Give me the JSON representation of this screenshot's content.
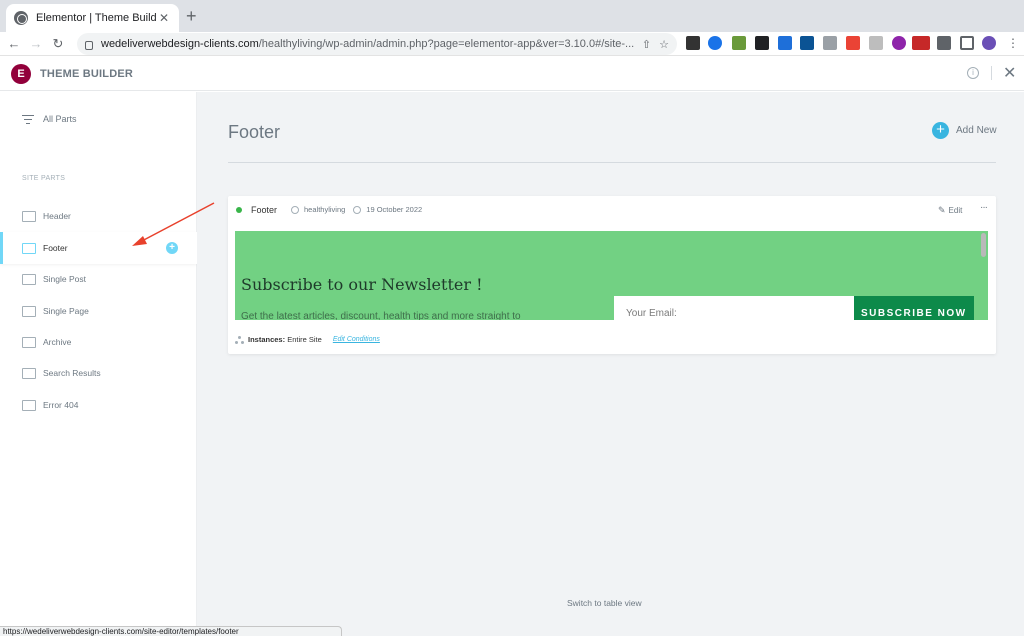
{
  "browser": {
    "tab_title": "Elementor | Theme Builder",
    "new_tab": "+",
    "url_domain": "wedeliverwebdesign-clients.com",
    "url_path": "/healthyliving/wp-admin/admin.php?page=elementor-app&ver=3.10.0#/site-..."
  },
  "app": {
    "logo_letter": "E",
    "title": "THEME BUILDER"
  },
  "sidebar": {
    "all_parts": "All Parts",
    "section_heading": "SITE PARTS",
    "items": [
      {
        "label": "Header"
      },
      {
        "label": "Footer"
      },
      {
        "label": "Single Post"
      },
      {
        "label": "Single Page"
      },
      {
        "label": "Archive"
      },
      {
        "label": "Search Results"
      },
      {
        "label": "Error 404"
      }
    ],
    "add_symbol": "+"
  },
  "main": {
    "title": "Footer",
    "add_new": "Add New",
    "switch_view": "Switch to table view"
  },
  "card": {
    "name": "Footer",
    "author": "healthyliving",
    "date": "19 October 2022",
    "edit": "Edit",
    "more": "···",
    "preview": {
      "heading": "Subscribe to our Newsletter !",
      "subtext": "Get the latest articles, discount, health tips and more straight to",
      "email_placeholder": "Your Email:",
      "button": "SUBSCRIBE NOW"
    },
    "instances_label": "Instances:",
    "instances_value": "Entire Site",
    "edit_conditions": "Edit Conditions"
  },
  "status_bar": {
    "link": "https://wedeliverwebdesign-clients.com/site-editor/templates/footer"
  },
  "colors": {
    "elementor_brand": "#92003b",
    "accent": "#71d7f7",
    "preview_bg": "#72d183",
    "subscribe_button": "#0d8a4a",
    "annotation_arrow": "#e8412c"
  }
}
